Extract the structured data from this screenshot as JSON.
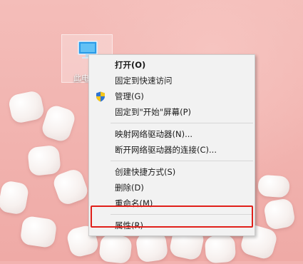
{
  "desktop_icon": {
    "label": "此电",
    "icon": "computer-icon"
  },
  "context_menu": {
    "items": [
      {
        "label": "打开(O)"
      },
      {
        "label": "固定到快速访问"
      },
      {
        "label": "管理(G)",
        "icon": "shield-icon"
      },
      {
        "label": "固定到\"开始\"屏幕(P)"
      },
      {
        "label": "映射网络驱动器(N)..."
      },
      {
        "label": "断开网络驱动器的连接(C)..."
      },
      {
        "label": "创建快捷方式(S)"
      },
      {
        "label": "删除(D)"
      },
      {
        "label": "重命名(M)"
      },
      {
        "label": "属性(R)"
      }
    ]
  },
  "colors": {
    "highlight_border": "#e0201a",
    "menu_background": "#f2f2f2",
    "wallpaper": "#f2b3b0"
  }
}
